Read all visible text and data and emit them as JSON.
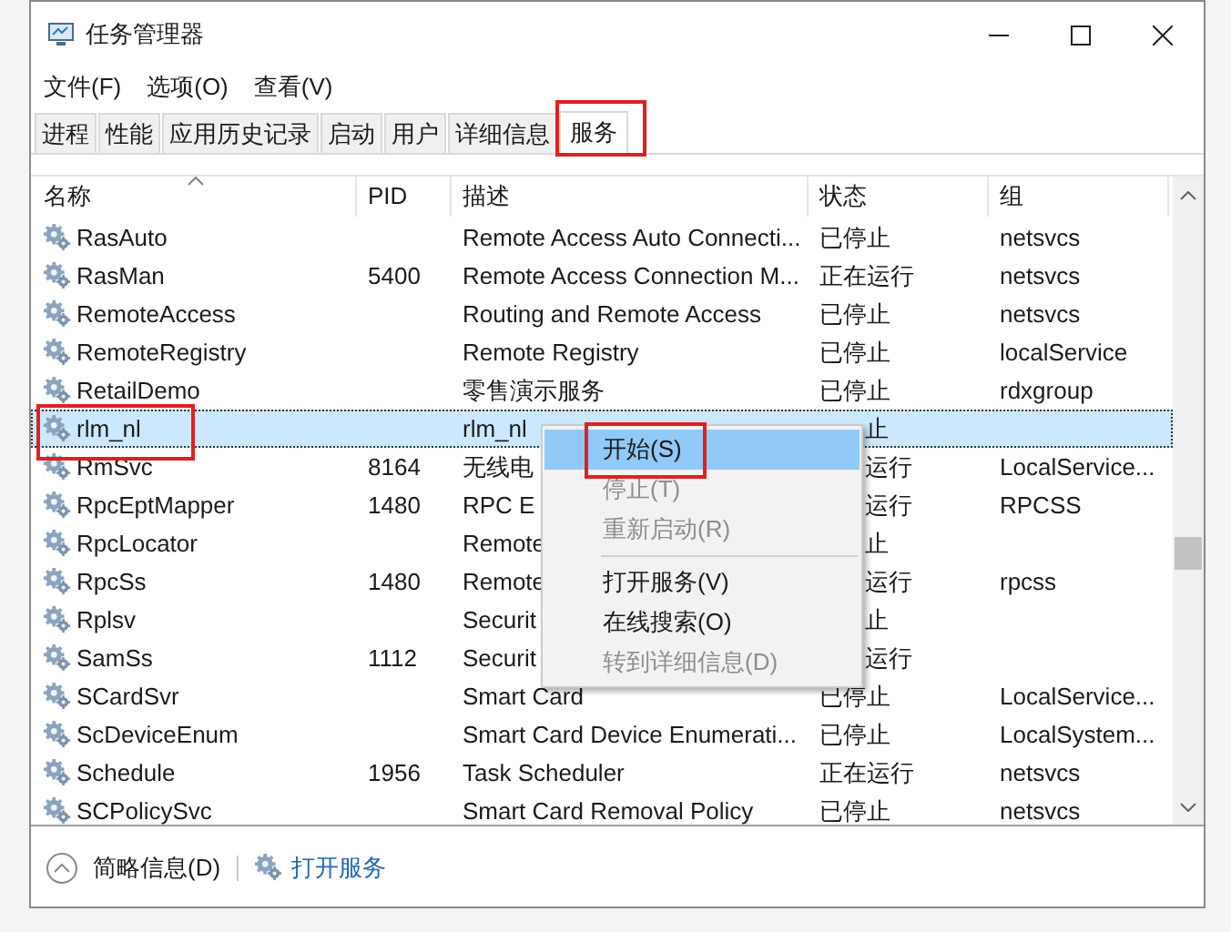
{
  "window": {
    "title": "任务管理器"
  },
  "menu_bar": [
    "文件(F)",
    "选项(O)",
    "查看(V)"
  ],
  "tabs": [
    {
      "label": "进程",
      "selected": false
    },
    {
      "label": "性能",
      "selected": false
    },
    {
      "label": "应用历史记录",
      "selected": false
    },
    {
      "label": "启动",
      "selected": false
    },
    {
      "label": "用户",
      "selected": false
    },
    {
      "label": "详细信息",
      "selected": false
    },
    {
      "label": "服务",
      "selected": true
    }
  ],
  "table": {
    "columns": [
      "名称",
      "PID",
      "描述",
      "状态",
      "组"
    ],
    "rows": [
      {
        "name": "RasAuto",
        "pid": "",
        "description": "Remote Access Auto Connecti...",
        "status": "已停止",
        "group": "netsvcs",
        "selected": false,
        "covered": false
      },
      {
        "name": "RasMan",
        "pid": "5400",
        "description": "Remote Access Connection M...",
        "status": "正在运行",
        "group": "netsvcs",
        "selected": false,
        "covered": false
      },
      {
        "name": "RemoteAccess",
        "pid": "",
        "description": "Routing and Remote Access",
        "status": "已停止",
        "group": "netsvcs",
        "selected": false,
        "covered": false
      },
      {
        "name": "RemoteRegistry",
        "pid": "",
        "description": "Remote Registry",
        "status": "已停止",
        "group": "localService",
        "selected": false,
        "covered": false
      },
      {
        "name": "RetailDemo",
        "pid": "",
        "description": "零售演示服务",
        "status": "已停止",
        "group": "rdxgroup",
        "selected": false,
        "covered": false
      },
      {
        "name": "rlm_nl",
        "pid": "",
        "description": "rlm_nl",
        "status": "止",
        "group": "",
        "selected": true,
        "covered": true
      },
      {
        "name": "RmSvc",
        "pid": "8164",
        "description": "无线电",
        "status": "运行",
        "group": "LocalService...",
        "selected": false,
        "covered": true
      },
      {
        "name": "RpcEptMapper",
        "pid": "1480",
        "description": "RPC E",
        "status": "运行",
        "group": "RPCSS",
        "selected": false,
        "covered": true
      },
      {
        "name": "RpcLocator",
        "pid": "",
        "description": "Remote",
        "status": "止",
        "group": "",
        "selected": false,
        "covered": true
      },
      {
        "name": "RpcSs",
        "pid": "1480",
        "description": "Remote",
        "status": "运行",
        "group": "rpcss",
        "selected": false,
        "covered": true
      },
      {
        "name": "Rplsv",
        "pid": "",
        "description": "Securit",
        "status": "止",
        "group": "",
        "selected": false,
        "covered": true
      },
      {
        "name": "SamSs",
        "pid": "1112",
        "description": "Securit",
        "status": "运行",
        "group": "",
        "selected": false,
        "covered": true
      },
      {
        "name": "SCardSvr",
        "pid": "",
        "description": "Smart Card",
        "status": "已停止",
        "group": "LocalService...",
        "selected": false,
        "covered": false
      },
      {
        "name": "ScDeviceEnum",
        "pid": "",
        "description": "Smart Card Device Enumerati...",
        "status": "已停止",
        "group": "LocalSystem...",
        "selected": false,
        "covered": false
      },
      {
        "name": "Schedule",
        "pid": "1956",
        "description": "Task Scheduler",
        "status": "正在运行",
        "group": "netsvcs",
        "selected": false,
        "covered": false
      },
      {
        "name": "SCPolicySvc",
        "pid": "",
        "description": "Smart Card Removal Policy",
        "status": "已停止",
        "group": "netsvcs",
        "selected": false,
        "covered": false
      }
    ]
  },
  "context_menu": [
    {
      "kind": "item",
      "label": "开始(S)",
      "disabled": false,
      "selected": true
    },
    {
      "kind": "item",
      "label": "停止(T)",
      "disabled": true,
      "selected": false
    },
    {
      "kind": "item",
      "label": "重新启动(R)",
      "disabled": true,
      "selected": false
    },
    {
      "kind": "separator"
    },
    {
      "kind": "item",
      "label": "打开服务(V)",
      "disabled": false,
      "selected": false
    },
    {
      "kind": "item",
      "label": "在线搜索(O)",
      "disabled": false,
      "selected": false
    },
    {
      "kind": "item",
      "label": "转到详细信息(D)",
      "disabled": true,
      "selected": false
    }
  ],
  "footer": {
    "fewer_details": "简略信息(D)",
    "open_services": "打开服务"
  }
}
